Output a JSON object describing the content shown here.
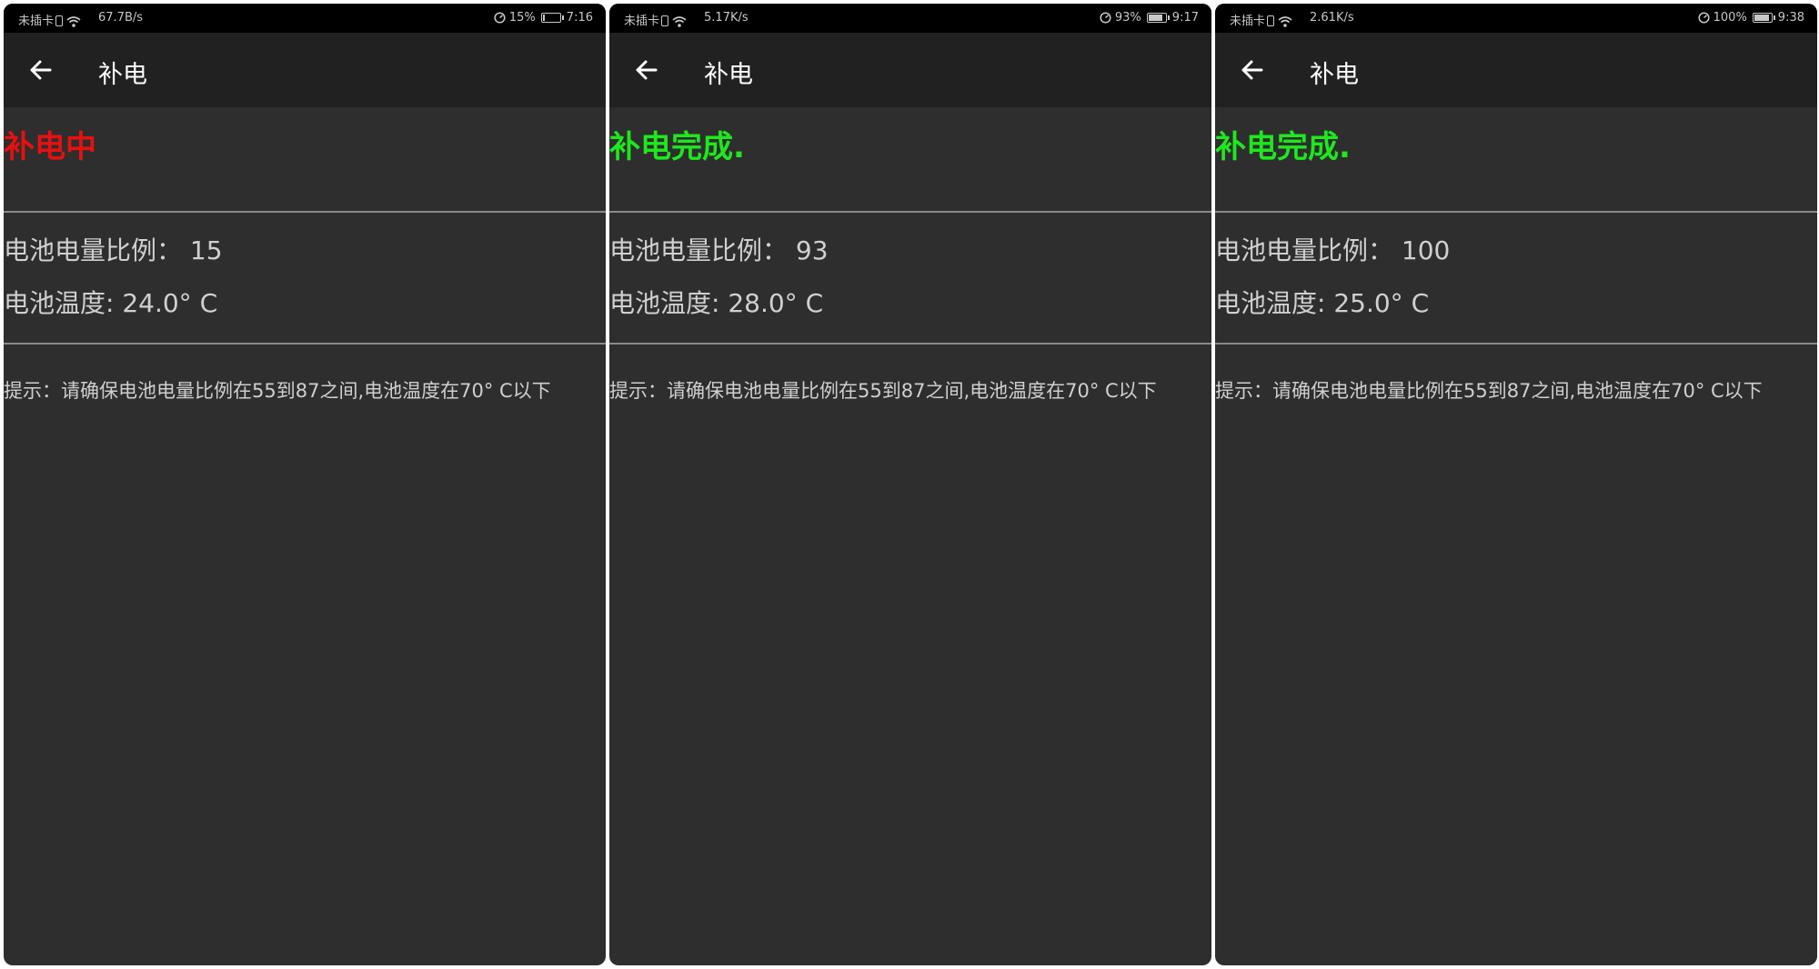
{
  "screens": [
    {
      "status_bar": {
        "carrier": "未插卡",
        "net_speed": "67.7B/s",
        "battery_percent": "15%",
        "battery_level": 0.15,
        "time": "7:16"
      },
      "app_bar": {
        "title": "补电"
      },
      "charge_status": {
        "text": "补电中",
        "color": "#e81010"
      },
      "battery_level_line": "电池电量比例：  15",
      "battery_temp_line": "电池温度: 24.0° C",
      "hint": "提示：请确保电池电量比例在55到87之间,电池温度在70° C以下"
    },
    {
      "status_bar": {
        "carrier": "未插卡",
        "net_speed": "5.17K/s",
        "battery_percent": "93%",
        "battery_level": 0.93,
        "time": "9:17"
      },
      "app_bar": {
        "title": "补电"
      },
      "charge_status": {
        "text": "补电完成.",
        "color": "#1ee81e"
      },
      "battery_level_line": "电池电量比例：  93",
      "battery_temp_line": "电池温度: 28.0° C",
      "hint": "提示：请确保电池电量比例在55到87之间,电池温度在70° C以下"
    },
    {
      "status_bar": {
        "carrier": "未插卡",
        "net_speed": "2.61K/s",
        "battery_percent": "100%",
        "battery_level": 1.0,
        "time": "9:38"
      },
      "app_bar": {
        "title": "补电"
      },
      "charge_status": {
        "text": "补电完成.",
        "color": "#1ee81e"
      },
      "battery_level_line": "电池电量比例：  100",
      "battery_temp_line": "电池温度: 25.0° C",
      "hint": "提示：请确保电池电量比例在55到87之间,电池温度在70° C以下"
    }
  ],
  "icons": {
    "back": "arrow-left",
    "wifi": "wifi",
    "sim": "no-sim-card",
    "gauge": "speed-gauge",
    "battery": "battery"
  }
}
